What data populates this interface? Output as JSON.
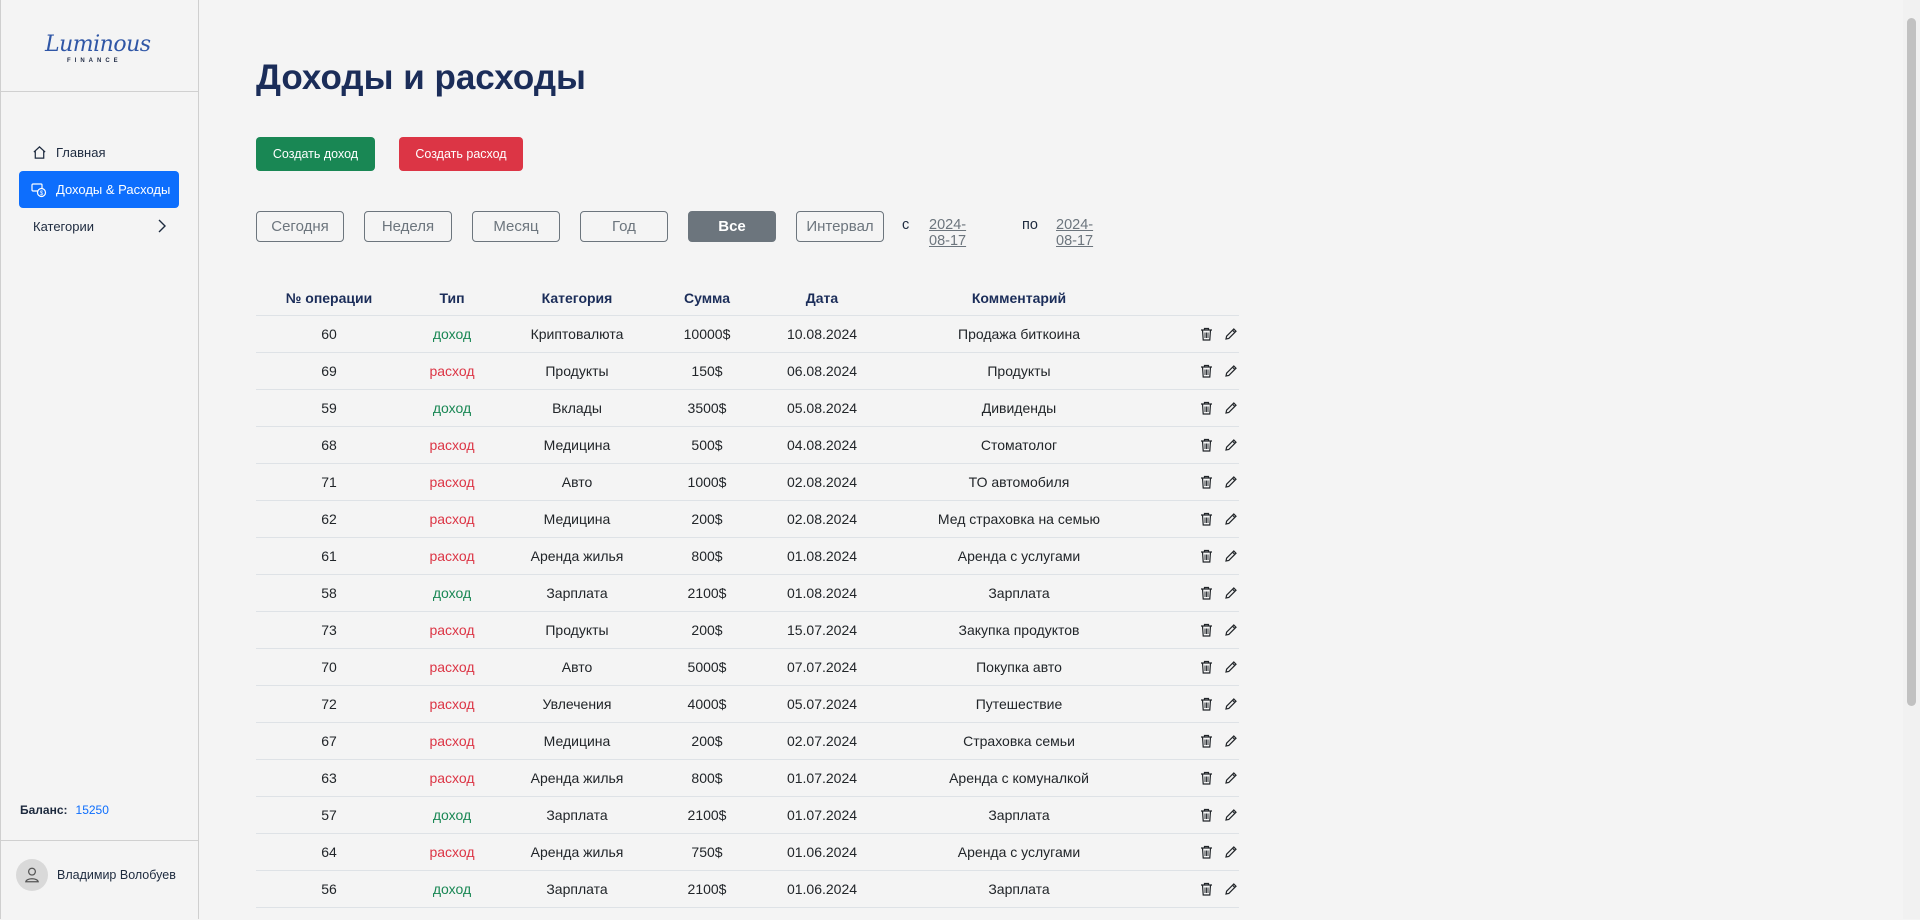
{
  "brand": {
    "script": "Luminous",
    "sub": "FINANCE"
  },
  "nav": [
    {
      "label": "Главная",
      "icon": "home-icon"
    },
    {
      "label": "Доходы & Расходы",
      "icon": "money-icon",
      "active": true
    },
    {
      "label": "Категории",
      "icon": "chevron-right-icon"
    }
  ],
  "balance": {
    "label": "Баланс:",
    "value": "15250"
  },
  "user": {
    "name": "Владимир Волобуев"
  },
  "page": {
    "title": "Доходы и расходы"
  },
  "actions": {
    "create_income": "Создать доход",
    "create_expense": "Создать расход"
  },
  "filters": {
    "today": "Сегодня",
    "week": "Неделя",
    "month": "Месяц",
    "year": "Год",
    "all": "Все",
    "interval": "Интервал",
    "from_label": "с",
    "from_date": "2024-08-17",
    "to_label": "по",
    "to_date": "2024-08-17",
    "active": "all"
  },
  "table": {
    "columns": [
      "№ операции",
      "Тип",
      "Категория",
      "Сумма",
      "Дата",
      "Комментарий"
    ],
    "rows": [
      {
        "id": "60",
        "type": "доход",
        "category": "Криптовалюта",
        "amount": "10000$",
        "date": "10.08.2024",
        "comment": "Продажа биткоина"
      },
      {
        "id": "69",
        "type": "расход",
        "category": "Продукты",
        "amount": "150$",
        "date": "06.08.2024",
        "comment": "Продукты"
      },
      {
        "id": "59",
        "type": "доход",
        "category": "Вклады",
        "amount": "3500$",
        "date": "05.08.2024",
        "comment": "Дивиденды"
      },
      {
        "id": "68",
        "type": "расход",
        "category": "Медицина",
        "amount": "500$",
        "date": "04.08.2024",
        "comment": "Стоматолог"
      },
      {
        "id": "71",
        "type": "расход",
        "category": "Авто",
        "amount": "1000$",
        "date": "02.08.2024",
        "comment": "ТО автомобиля"
      },
      {
        "id": "62",
        "type": "расход",
        "category": "Медицина",
        "amount": "200$",
        "date": "02.08.2024",
        "comment": "Мед страховка на семью"
      },
      {
        "id": "61",
        "type": "расход",
        "category": "Аренда жилья",
        "amount": "800$",
        "date": "01.08.2024",
        "comment": "Аренда с услугами"
      },
      {
        "id": "58",
        "type": "доход",
        "category": "Зарплата",
        "amount": "2100$",
        "date": "01.08.2024",
        "comment": "Зарплата"
      },
      {
        "id": "73",
        "type": "расход",
        "category": "Продукты",
        "amount": "200$",
        "date": "15.07.2024",
        "comment": "Закупка продуктов"
      },
      {
        "id": "70",
        "type": "расход",
        "category": "Авто",
        "amount": "5000$",
        "date": "07.07.2024",
        "comment": "Покупка авто"
      },
      {
        "id": "72",
        "type": "расход",
        "category": "Увлечения",
        "amount": "4000$",
        "date": "05.07.2024",
        "comment": "Путешествие"
      },
      {
        "id": "67",
        "type": "расход",
        "category": "Медицина",
        "amount": "200$",
        "date": "02.07.2024",
        "comment": "Страховка семьи"
      },
      {
        "id": "63",
        "type": "расход",
        "category": "Аренда жилья",
        "amount": "800$",
        "date": "01.07.2024",
        "comment": "Аренда с комуналкой"
      },
      {
        "id": "57",
        "type": "доход",
        "category": "Зарплата",
        "amount": "2100$",
        "date": "01.07.2024",
        "comment": "Зарплата"
      },
      {
        "id": "64",
        "type": "расход",
        "category": "Аренда жилья",
        "amount": "750$",
        "date": "01.06.2024",
        "comment": "Аренда с услугами"
      },
      {
        "id": "56",
        "type": "доход",
        "category": "Зарплата",
        "amount": "2100$",
        "date": "01.06.2024",
        "comment": "Зарплата"
      }
    ],
    "row_icons": [
      "trash-icon",
      "pencil-icon"
    ]
  },
  "colors": {
    "income": "#198754",
    "expense": "#dc3545",
    "primary": "#0d6efd",
    "title": "#1b2d59",
    "muted": "#6c757d"
  }
}
